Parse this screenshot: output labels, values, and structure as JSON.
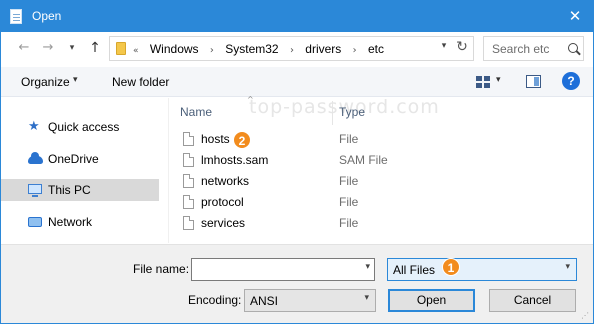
{
  "window": {
    "title": "Open",
    "close_glyph": "✕",
    "accent_color": "#2b88d8"
  },
  "address": {
    "back_glyph": "←",
    "forward_glyph": "→",
    "recent_glyph": "▾",
    "up_glyph": "↑",
    "overflow": "«",
    "crumbs": [
      "Windows",
      "System32",
      "drivers",
      "etc"
    ],
    "separator": "›",
    "dropdown_glyph": "▾",
    "refresh_glyph": "↻"
  },
  "search": {
    "placeholder": "Search etc"
  },
  "toolbar": {
    "organize_label": "Organize",
    "organize_dd": "▾",
    "new_folder_label": "New folder",
    "view_dd": "▾",
    "help_label": "?"
  },
  "nav": {
    "items": [
      {
        "label": "Quick access",
        "icon": "star-icon",
        "selected": false
      },
      {
        "label": "OneDrive",
        "icon": "cloud-icon",
        "selected": false
      },
      {
        "label": "This PC",
        "icon": "computer-icon",
        "selected": true
      },
      {
        "label": "Network",
        "icon": "network-icon",
        "selected": false
      }
    ]
  },
  "files": {
    "watermark": "top-password.com",
    "sort_glyph": "^",
    "columns": {
      "name": "Name",
      "type": "Type"
    },
    "rows": [
      {
        "name": "hosts",
        "type": "File"
      },
      {
        "name": "lmhosts.sam",
        "type": "SAM File"
      },
      {
        "name": "networks",
        "type": "File"
      },
      {
        "name": "protocol",
        "type": "File"
      },
      {
        "name": "services",
        "type": "File"
      }
    ]
  },
  "bottom": {
    "filename_label": "File name:",
    "filename_value": "",
    "filename_dd": "▾",
    "filter_value": "All Files",
    "filter_dd": "▾",
    "encoding_label": "Encoding:",
    "encoding_value": "ANSI",
    "encoding_dd": "▾",
    "open_label": "Open",
    "cancel_label": "Cancel",
    "grip": "⋰"
  },
  "annotations": [
    {
      "number": "1",
      "color": "#f28c1e"
    },
    {
      "number": "2",
      "color": "#f28c1e"
    }
  ]
}
